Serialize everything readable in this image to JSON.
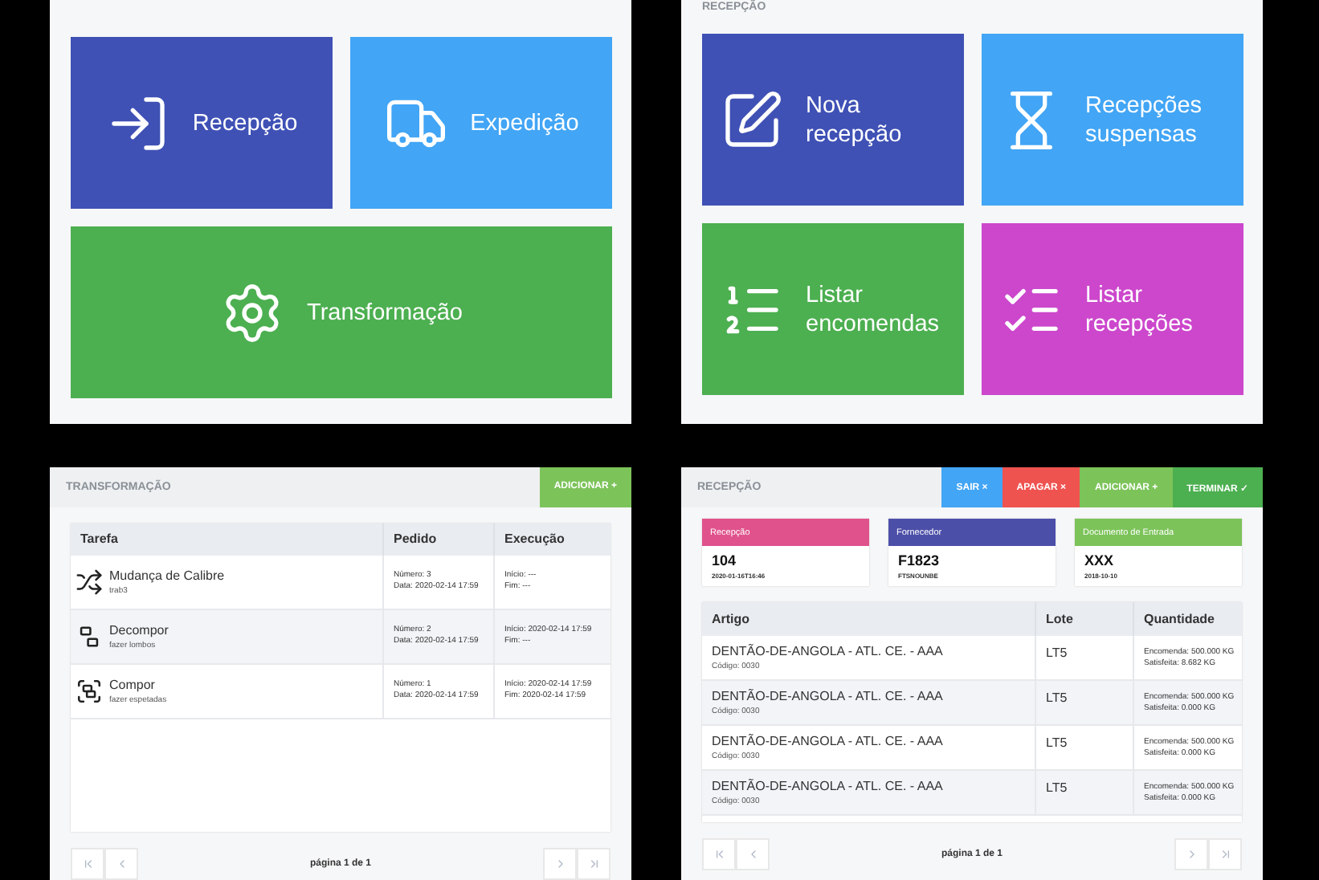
{
  "main_menu": {
    "tiles": [
      {
        "label": "Recepção",
        "color": "#3f51b5",
        "wide": false
      },
      {
        "label": "Expedição",
        "color": "#42a5f5",
        "wide": false
      },
      {
        "label": "Transformação",
        "color": "#4caf50",
        "wide": true
      }
    ]
  },
  "reception_menu": {
    "title": "RECEPÇÃO",
    "tiles": [
      {
        "label": "Nova recepção",
        "color": "#3f51b5",
        "wide": false
      },
      {
        "label": "Recepções suspensas",
        "color": "#42a5f5",
        "wide": false
      },
      {
        "label": "Listar encomendas",
        "color": "#4caf50",
        "wide": false
      },
      {
        "label": "Listar recepções",
        "color": "#cc47cc",
        "wide": false
      }
    ]
  },
  "transformation": {
    "title": "TRANSFORMAÇÃO",
    "actions": [
      {
        "label": "ADICIONAR +",
        "color": "#7cc35a"
      }
    ],
    "columns": [
      "Tarefa",
      "Pedido",
      "Execução"
    ],
    "rows": [
      {
        "name": "Mudança de Calibre",
        "note": "trab3",
        "order": [
          "Número: 3",
          "Data: 2020-02-14 17:59"
        ],
        "execution": [
          "Início: ---",
          "Fim: ---"
        ]
      },
      {
        "name": "Decompor",
        "note": "fazer lombos",
        "order": [
          "Número: 2",
          "Data: 2020-02-14 17:59"
        ],
        "execution": [
          "Início: 2020-02-14 17:59",
          "Fim: ---"
        ]
      },
      {
        "name": "Compor",
        "note": "fazer espetadas",
        "order": [
          "Número: 1",
          "Data: 2020-02-14 17:59"
        ],
        "execution": [
          "Início: 2020-02-14 17:59",
          "Fim: 2020-02-14 17:59"
        ]
      }
    ],
    "pagination": "página 1 de 1"
  },
  "reception": {
    "title": "RECEPÇÃO",
    "actions": [
      {
        "label": "SAIR ×",
        "color": "#42a5f5"
      },
      {
        "label": "APAGAR ×",
        "color": "#ef5350"
      },
      {
        "label": "ADICIONAR +",
        "color": "#7cc35a"
      },
      {
        "label": "TERMINAR ✓",
        "color": "#4caf50"
      }
    ],
    "cards": [
      {
        "title": "Recepção",
        "color": "#e0528c",
        "value": "104",
        "note": "2020-01-16T16:46"
      },
      {
        "title": "Fornecedor",
        "color": "#4c4fa8",
        "value": "F1823",
        "note": "FTSNOUNBE"
      },
      {
        "title": "Documento de Entrada",
        "color": "#7cc35a",
        "value": "XXX",
        "note": "2018-10-10"
      }
    ],
    "columns": [
      "Artigo",
      "Lote",
      "Quantidade"
    ],
    "rows": [
      {
        "name": "DENTÃO-DE-ANGOLA - ATL. CE. - AAA",
        "code": "Código: 0030",
        "lot": "LT5",
        "ordered": "Encomenda: 500.000 KG",
        "fulfilled": "Satisfeita: 8.682 KG"
      },
      {
        "name": "DENTÃO-DE-ANGOLA - ATL. CE. - AAA",
        "code": "Código: 0030",
        "lot": "LT5",
        "ordered": "Encomenda: 500.000 KG",
        "fulfilled": "Satisfeita: 0.000 KG"
      },
      {
        "name": "DENTÃO-DE-ANGOLA - ATL. CE. - AAA",
        "code": "Código: 0030",
        "lot": "LT5",
        "ordered": "Encomenda: 500.000 KG",
        "fulfilled": "Satisfeita: 0.000 KG"
      },
      {
        "name": "DENTÃO-DE-ANGOLA - ATL. CE. - AAA",
        "code": "Código: 0030",
        "lot": "LT5",
        "ordered": "Encomenda: 500.000 KG",
        "fulfilled": "Satisfeita: 0.000 KG"
      }
    ],
    "pagination": "página 1 de 1"
  }
}
